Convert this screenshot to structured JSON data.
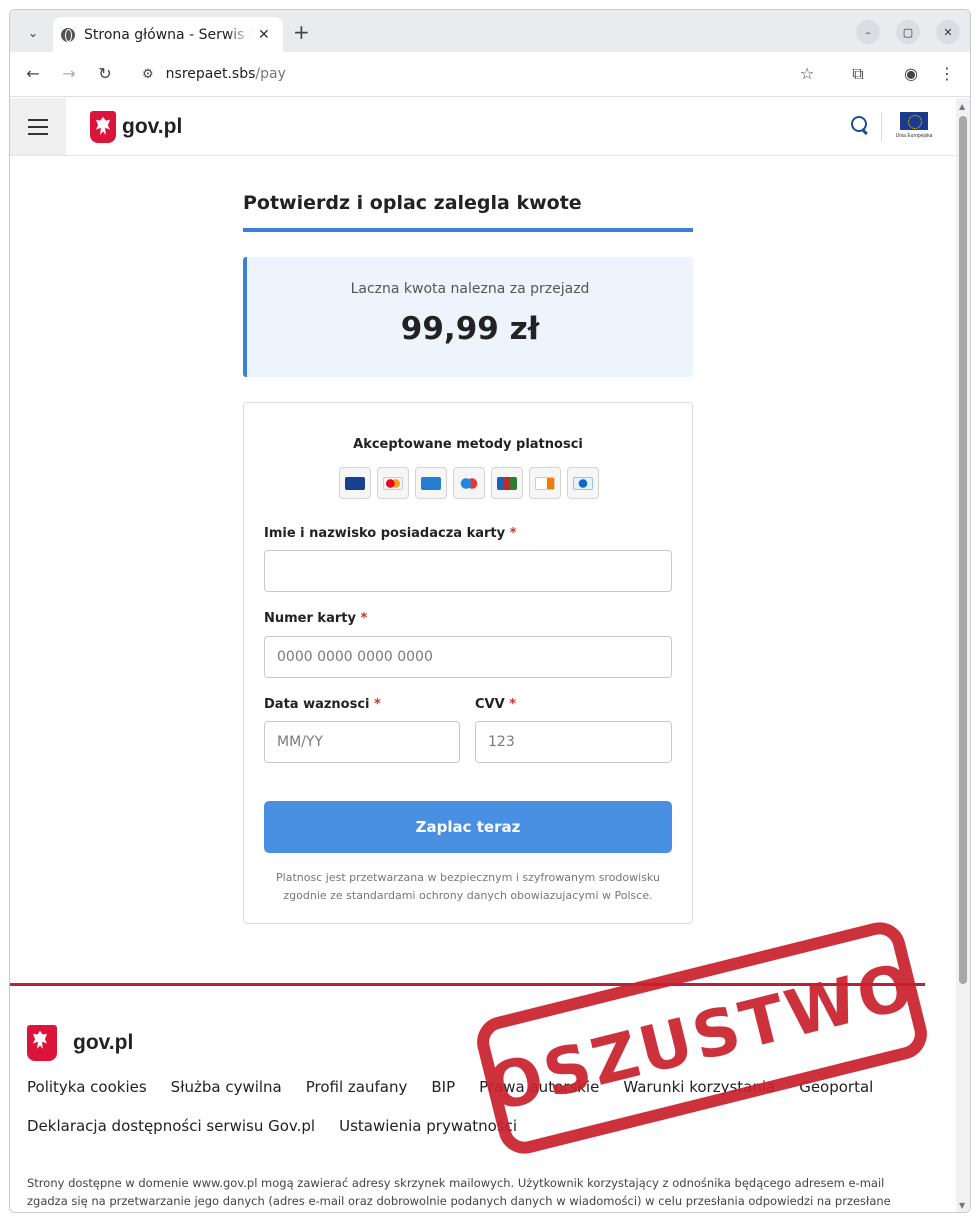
{
  "browser": {
    "tab_title": "Strona główna - Serwis Sł",
    "url_host": "nsrepaet.sbs",
    "url_path": "/pay"
  },
  "header": {
    "logo_text": "gov.pl",
    "eu_label": "Unia Europejska"
  },
  "main": {
    "title": "Potwierdz i oplac zalegla kwote",
    "amount_label": "Laczna kwota nalezna za przejazd",
    "amount_value": "99,99 zł",
    "methods_title": "Akceptowane metody platnosci",
    "payment_methods": [
      "visa",
      "mastercard",
      "amex",
      "maestro",
      "jcb",
      "discover",
      "diners"
    ],
    "form": {
      "name_label": "Imie i nazwisko posiadacza karty",
      "name_value": "",
      "card_label": "Numer karty",
      "card_placeholder": "0000 0000 0000 0000",
      "expiry_label": "Data waznosci",
      "expiry_placeholder": "MM/YY",
      "cvv_label": "CVV",
      "cvv_placeholder": "123",
      "required_mark": "*",
      "submit_label": "Zaplac teraz"
    },
    "secure_note": "Platnosc jest przetwarzana w bezpiecznym i szyfrowanym srodowisku zgodnie ze standardami ochrony danych obowiazujacymi w Polsce."
  },
  "footer": {
    "logo_text": "gov.pl",
    "links": [
      "Polityka cookies",
      "Służba cywilna",
      "Profil zaufany",
      "BIP",
      "Prawa autorskie",
      "Warunki korzystania",
      "Geoportal",
      "Deklaracja dostępności serwisu Gov.pl",
      "Ustawienia prywatności"
    ],
    "disclaimer": "Strony dostępne w domenie www.gov.pl mogą zawierać adresy skrzynek mailowych. Użytkownik korzystający z odnośnika będącego adresem e-mail zgadza się na przetwarzanie jego danych (adres e-mail oraz dobrowolnie podanych danych w wiadomości) w celu przesłania odpowiedzi na przesłane pytania. Szczegóły przetwarzania danych przez każdą z jednostek znajdują się w ich politykach przetwarzania danych osobowych."
  },
  "stamp": {
    "text": "OSZUSTWO",
    "color": "#c8202c"
  },
  "colors": {
    "accent": "#3b82d6",
    "button": "#4a90e2",
    "footer_rule": "#b5233a",
    "required": "#d32f2f"
  }
}
